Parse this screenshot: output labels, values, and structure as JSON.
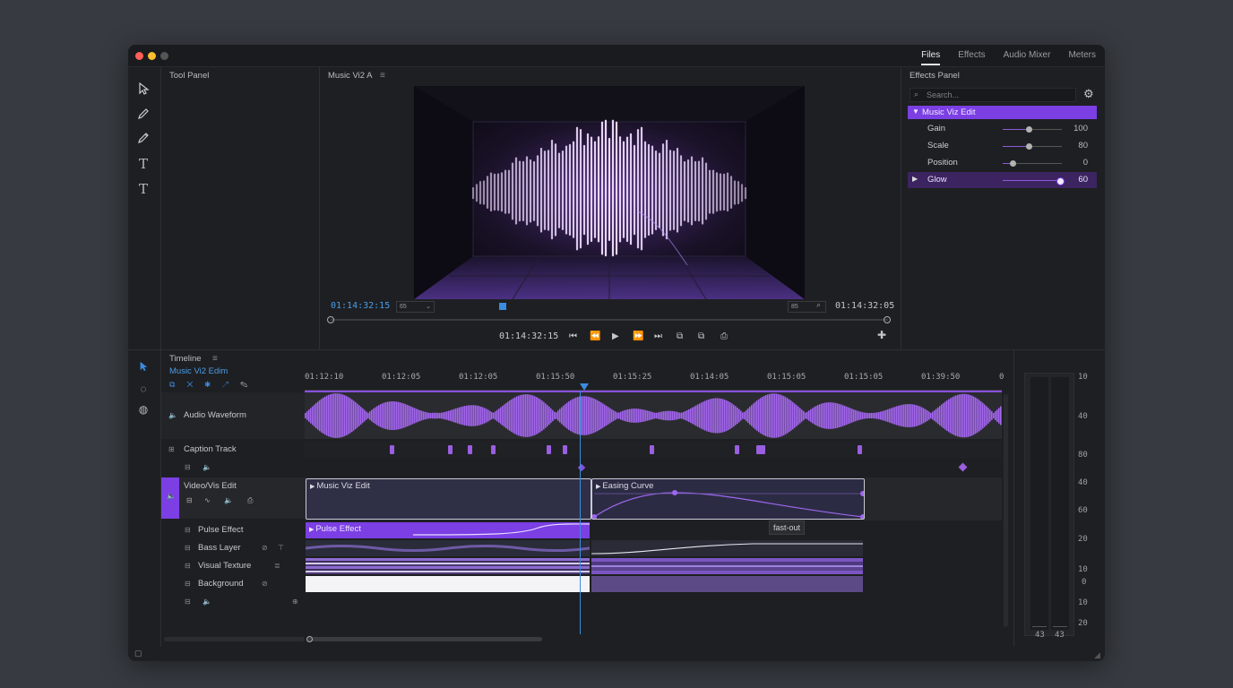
{
  "tabs": [
    "Files",
    "Effects",
    "Audio Mixer",
    "Meters"
  ],
  "tool_panel": {
    "title": "Tool Panel"
  },
  "program": {
    "title": "Music Vi2 A",
    "timecode_left": "01:14:32:15",
    "timecode_right": "01:14:32:05",
    "timecode_center": "01:14:32:15",
    "zoom_left": "65",
    "zoom_right": "85"
  },
  "effects": {
    "title": "Effects Panel",
    "search_placeholder": "Search...",
    "group": "Music Viz Edit",
    "params": [
      {
        "label": "Gain",
        "value": "100",
        "level": 0.45
      },
      {
        "label": "Scale",
        "value": "80",
        "level": 0.45
      },
      {
        "label": "Position",
        "value": "0",
        "level": 0.18
      },
      {
        "label": "Glow",
        "value": "60",
        "level": 0.95
      }
    ]
  },
  "timeline": {
    "title": "Timeline",
    "sequence": "Music Vi2 Edim",
    "ruler": [
      "01:12:10",
      "01:12:05",
      "01:12:05",
      "01:15:50",
      "01:15:25",
      "01:14:05",
      "01:15:05",
      "01:15:05",
      "01:39:50",
      "0"
    ],
    "tracks": {
      "audio_waveform": "Audio Waveform",
      "caption": "Caption Track",
      "video": "Video/Vis Edit",
      "pulse": "Pulse Effect",
      "bass": "Bass Layer",
      "texture": "Visual Texture",
      "background": "Background"
    },
    "clips": {
      "music_viz": "Music Viz Edit",
      "easing": "Easing Curve",
      "pulse": "Pulse Effect",
      "tooltip": "fast-out"
    }
  },
  "meters": {
    "scale": [
      "10",
      "40",
      "80",
      "40",
      "60",
      "20",
      "10",
      "0",
      "10",
      "20"
    ],
    "channels": [
      "43",
      "43"
    ]
  },
  "colors": {
    "accent": "#8a4fe0",
    "playhead": "#3b8cdf",
    "timecode": "#4a9de8"
  }
}
